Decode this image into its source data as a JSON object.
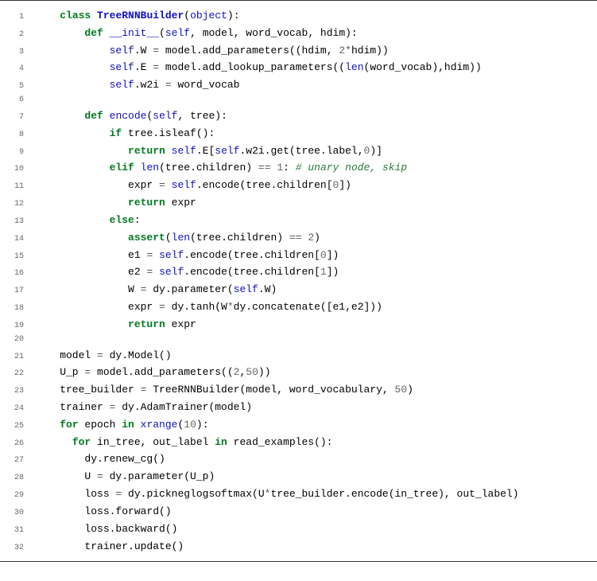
{
  "code": {
    "lines": [
      {
        "n": "1",
        "segs": [
          [
            "    ",
            ""
          ],
          [
            "class",
            "kw"
          ],
          [
            " ",
            ""
          ],
          [
            "TreeRNNBuilder",
            "cls"
          ],
          [
            "(",
            ""
          ],
          [
            "object",
            "fn"
          ],
          [
            "):",
            ""
          ]
        ]
      },
      {
        "n": "2",
        "segs": [
          [
            "        ",
            ""
          ],
          [
            "def",
            "kw"
          ],
          [
            " ",
            ""
          ],
          [
            "__init__",
            "fn"
          ],
          [
            "(",
            ""
          ],
          [
            "self",
            "fn"
          ],
          [
            ", model, word_vocab, hdim):",
            ""
          ]
        ]
      },
      {
        "n": "3",
        "segs": [
          [
            "            ",
            ""
          ],
          [
            "self",
            "fn"
          ],
          [
            ".W ",
            ""
          ],
          [
            "=",
            "op"
          ],
          [
            " model.add_parameters((hdim, ",
            ""
          ],
          [
            "2",
            "num"
          ],
          [
            "*",
            "op"
          ],
          [
            "hdim))",
            ""
          ]
        ]
      },
      {
        "n": "4",
        "segs": [
          [
            "            ",
            ""
          ],
          [
            "self",
            "fn"
          ],
          [
            ".E ",
            ""
          ],
          [
            "=",
            "op"
          ],
          [
            " model.add_lookup_parameters((",
            ""
          ],
          [
            "len",
            "fn"
          ],
          [
            "(word_vocab),hdim))",
            ""
          ]
        ]
      },
      {
        "n": "5",
        "segs": [
          [
            "            ",
            ""
          ],
          [
            "self",
            "fn"
          ],
          [
            ".w2i ",
            ""
          ],
          [
            "=",
            "op"
          ],
          [
            " word_vocab",
            ""
          ]
        ]
      },
      {
        "n": "6",
        "segs": [
          [
            "",
            ""
          ]
        ]
      },
      {
        "n": "7",
        "segs": [
          [
            "        ",
            ""
          ],
          [
            "def",
            "kw"
          ],
          [
            " ",
            ""
          ],
          [
            "encode",
            "fn"
          ],
          [
            "(",
            ""
          ],
          [
            "self",
            "fn"
          ],
          [
            ", tree):",
            ""
          ]
        ]
      },
      {
        "n": "8",
        "segs": [
          [
            "            ",
            ""
          ],
          [
            "if",
            "kw"
          ],
          [
            " tree.isleaf():",
            ""
          ]
        ]
      },
      {
        "n": "9",
        "segs": [
          [
            "               ",
            ""
          ],
          [
            "return",
            "kw"
          ],
          [
            " ",
            ""
          ],
          [
            "self",
            "fn"
          ],
          [
            ".E[",
            ""
          ],
          [
            "self",
            "fn"
          ],
          [
            ".w2i.get(tree.label,",
            ""
          ],
          [
            "0",
            "num"
          ],
          [
            ")]",
            ""
          ]
        ]
      },
      {
        "n": "10",
        "segs": [
          [
            "            ",
            ""
          ],
          [
            "elif",
            "kw"
          ],
          [
            " ",
            ""
          ],
          [
            "len",
            "fn"
          ],
          [
            "(tree.children) ",
            ""
          ],
          [
            "==",
            "op"
          ],
          [
            " ",
            ""
          ],
          [
            "1",
            "num"
          ],
          [
            ": ",
            ""
          ],
          [
            "# unary node, skip",
            "cmt"
          ]
        ]
      },
      {
        "n": "11",
        "segs": [
          [
            "               expr ",
            ""
          ],
          [
            "=",
            "op"
          ],
          [
            " ",
            ""
          ],
          [
            "self",
            "fn"
          ],
          [
            ".encode(tree.children[",
            ""
          ],
          [
            "0",
            "num"
          ],
          [
            "])",
            ""
          ]
        ]
      },
      {
        "n": "12",
        "segs": [
          [
            "               ",
            ""
          ],
          [
            "return",
            "kw"
          ],
          [
            " expr",
            ""
          ]
        ]
      },
      {
        "n": "13",
        "segs": [
          [
            "            ",
            ""
          ],
          [
            "else",
            "kw"
          ],
          [
            ":",
            ""
          ]
        ]
      },
      {
        "n": "14",
        "segs": [
          [
            "               ",
            ""
          ],
          [
            "assert",
            "kw"
          ],
          [
            "(",
            ""
          ],
          [
            "len",
            "fn"
          ],
          [
            "(tree.children) ",
            ""
          ],
          [
            "==",
            "op"
          ],
          [
            " ",
            ""
          ],
          [
            "2",
            "num"
          ],
          [
            ")",
            ""
          ]
        ]
      },
      {
        "n": "15",
        "segs": [
          [
            "               e1 ",
            ""
          ],
          [
            "=",
            "op"
          ],
          [
            " ",
            ""
          ],
          [
            "self",
            "fn"
          ],
          [
            ".encode(tree.children[",
            ""
          ],
          [
            "0",
            "num"
          ],
          [
            "])",
            ""
          ]
        ]
      },
      {
        "n": "16",
        "segs": [
          [
            "               e2 ",
            ""
          ],
          [
            "=",
            "op"
          ],
          [
            " ",
            ""
          ],
          [
            "self",
            "fn"
          ],
          [
            ".encode(tree.children[",
            ""
          ],
          [
            "1",
            "num"
          ],
          [
            "])",
            ""
          ]
        ]
      },
      {
        "n": "17",
        "segs": [
          [
            "               W ",
            ""
          ],
          [
            "=",
            "op"
          ],
          [
            " dy.parameter(",
            ""
          ],
          [
            "self",
            "fn"
          ],
          [
            ".W)",
            ""
          ]
        ]
      },
      {
        "n": "18",
        "segs": [
          [
            "               expr ",
            ""
          ],
          [
            "=",
            "op"
          ],
          [
            " dy.tanh(W",
            ""
          ],
          [
            "*",
            "op"
          ],
          [
            "dy.concatenate([e1,e2]))",
            ""
          ]
        ]
      },
      {
        "n": "19",
        "segs": [
          [
            "               ",
            ""
          ],
          [
            "return",
            "kw"
          ],
          [
            " expr",
            ""
          ]
        ]
      },
      {
        "n": "20",
        "segs": [
          [
            "",
            ""
          ]
        ]
      },
      {
        "n": "21",
        "segs": [
          [
            "    model ",
            ""
          ],
          [
            "=",
            "op"
          ],
          [
            " dy.Model()",
            ""
          ]
        ]
      },
      {
        "n": "22",
        "segs": [
          [
            "    U_p ",
            ""
          ],
          [
            "=",
            "op"
          ],
          [
            " model.add_parameters((",
            ""
          ],
          [
            "2",
            "num"
          ],
          [
            ",",
            ""
          ],
          [
            "50",
            "num"
          ],
          [
            "))",
            ""
          ]
        ]
      },
      {
        "n": "23",
        "segs": [
          [
            "    tree_builder ",
            ""
          ],
          [
            "=",
            "op"
          ],
          [
            " TreeRNNBuilder(model, word_vocabulary, ",
            ""
          ],
          [
            "50",
            "num"
          ],
          [
            ")",
            ""
          ]
        ]
      },
      {
        "n": "24",
        "segs": [
          [
            "    trainer ",
            ""
          ],
          [
            "=",
            "op"
          ],
          [
            " dy.AdamTrainer(model)",
            ""
          ]
        ]
      },
      {
        "n": "25",
        "segs": [
          [
            "    ",
            ""
          ],
          [
            "for",
            "kw"
          ],
          [
            " epoch ",
            ""
          ],
          [
            "in",
            "kw"
          ],
          [
            " ",
            ""
          ],
          [
            "xrange",
            "fn"
          ],
          [
            "(",
            ""
          ],
          [
            "10",
            "num"
          ],
          [
            "):",
            ""
          ]
        ]
      },
      {
        "n": "26",
        "segs": [
          [
            "      ",
            ""
          ],
          [
            "for",
            "kw"
          ],
          [
            " in_tree, out_label ",
            ""
          ],
          [
            "in",
            "kw"
          ],
          [
            " read_examples():",
            ""
          ]
        ]
      },
      {
        "n": "27",
        "segs": [
          [
            "        dy.renew_cg()",
            ""
          ]
        ]
      },
      {
        "n": "28",
        "segs": [
          [
            "        U ",
            ""
          ],
          [
            "=",
            "op"
          ],
          [
            " dy.parameter(U_p)",
            ""
          ]
        ]
      },
      {
        "n": "29",
        "segs": [
          [
            "        loss ",
            ""
          ],
          [
            "=",
            "op"
          ],
          [
            " dy.pickneglogsoftmax(U",
            ""
          ],
          [
            "*",
            "op"
          ],
          [
            "tree_builder.encode(in_tree), out_label)",
            ""
          ]
        ]
      },
      {
        "n": "30",
        "segs": [
          [
            "        loss.forward()",
            ""
          ]
        ]
      },
      {
        "n": "31",
        "segs": [
          [
            "        loss.backward()",
            ""
          ]
        ]
      },
      {
        "n": "32",
        "segs": [
          [
            "        trainer.update()",
            ""
          ]
        ]
      }
    ]
  }
}
